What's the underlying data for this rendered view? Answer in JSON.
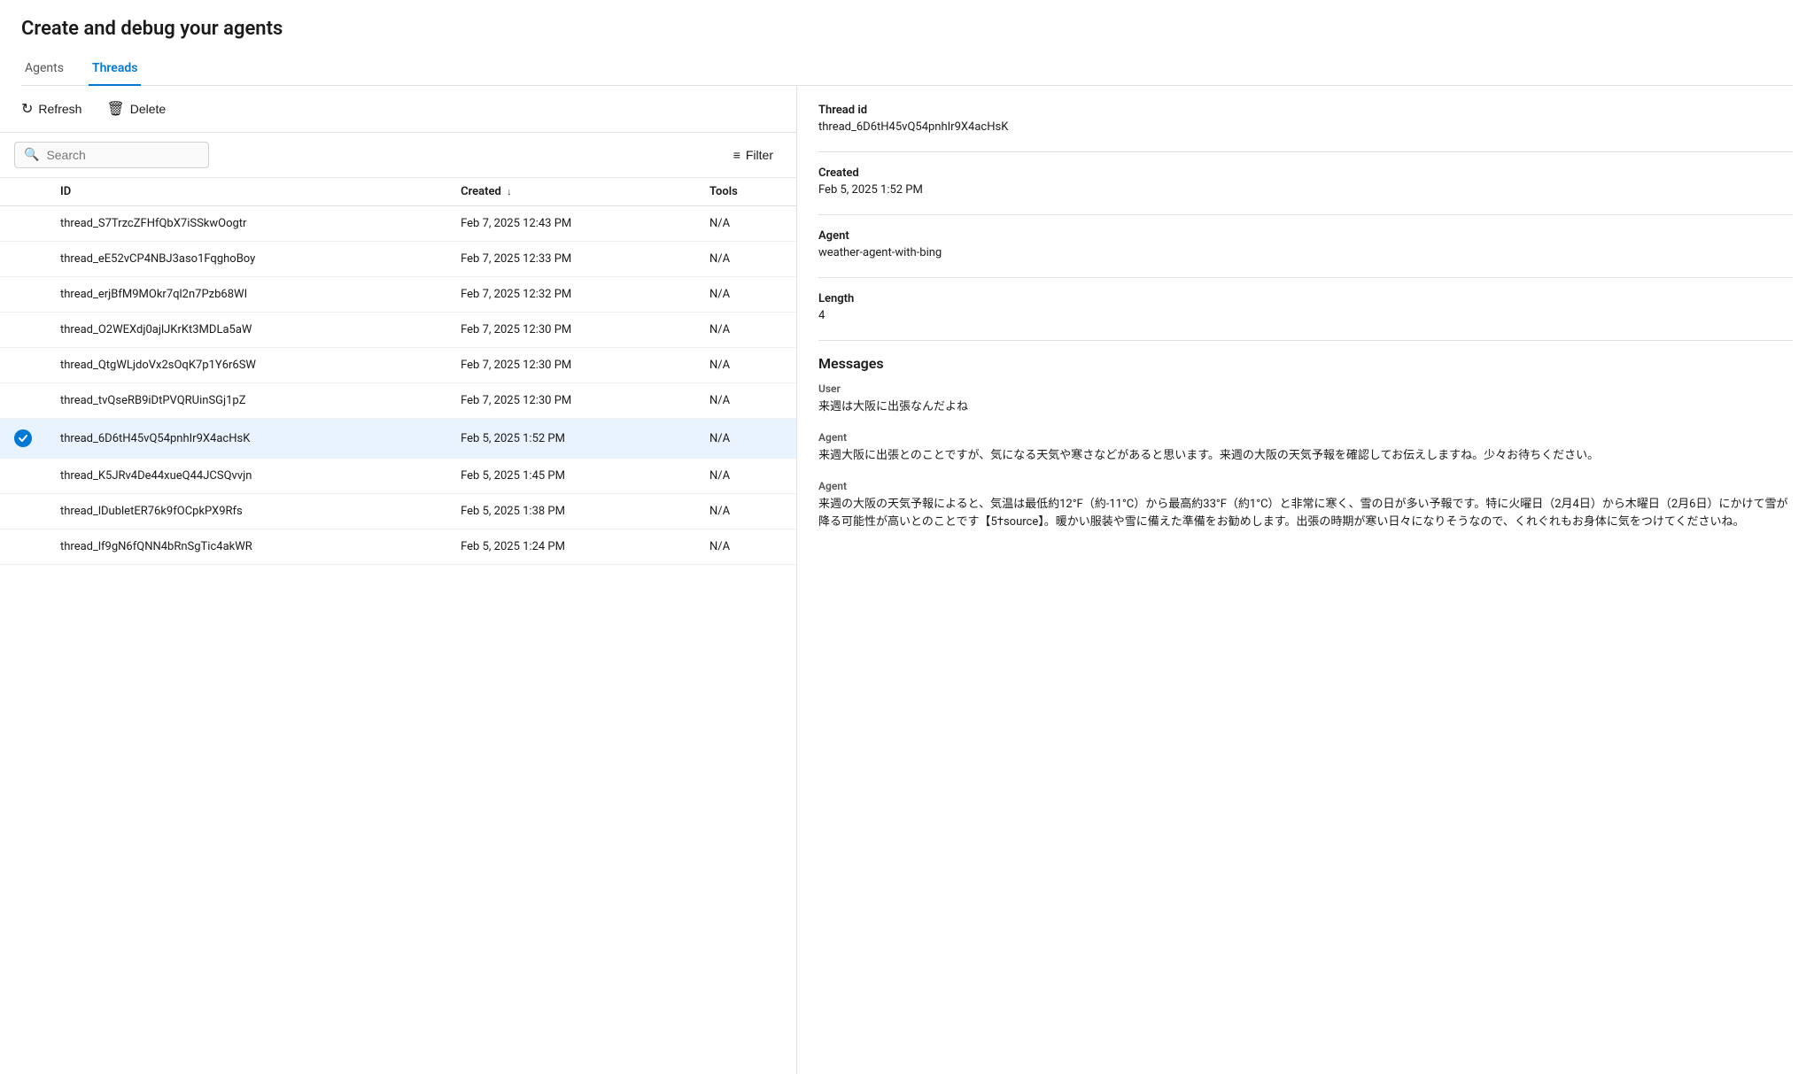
{
  "page": {
    "title": "Create and debug your agents"
  },
  "tabs": [
    {
      "id": "agents",
      "label": "Agents",
      "active": false
    },
    {
      "id": "threads",
      "label": "Threads",
      "active": true
    }
  ],
  "toolbar": {
    "refresh_label": "Refresh",
    "delete_label": "Delete"
  },
  "search": {
    "placeholder": "Search"
  },
  "filter": {
    "label": "Filter"
  },
  "table": {
    "columns": [
      {
        "id": "check",
        "label": ""
      },
      {
        "id": "id",
        "label": "ID"
      },
      {
        "id": "created",
        "label": "Created"
      },
      {
        "id": "tools",
        "label": "Tools"
      }
    ],
    "rows": [
      {
        "id": "thread_S7TrzcZFHfQbX7iSSkwOogtr",
        "created": "Feb 7, 2025 12:43 PM",
        "tools": "N/A",
        "selected": false
      },
      {
        "id": "thread_eE52vCP4NBJ3aso1FqghoBoy",
        "created": "Feb 7, 2025 12:33 PM",
        "tools": "N/A",
        "selected": false
      },
      {
        "id": "thread_erjBfM9MOkr7ql2n7Pzb68WI",
        "created": "Feb 7, 2025 12:32 PM",
        "tools": "N/A",
        "selected": false
      },
      {
        "id": "thread_O2WEXdj0ajlJKrKt3MDLa5aW",
        "created": "Feb 7, 2025 12:30 PM",
        "tools": "N/A",
        "selected": false
      },
      {
        "id": "thread_QtgWLjdoVx2sOqK7p1Y6r6SW",
        "created": "Feb 7, 2025 12:30 PM",
        "tools": "N/A",
        "selected": false
      },
      {
        "id": "thread_tvQseRB9iDtPVQRUinSGj1pZ",
        "created": "Feb 7, 2025 12:30 PM",
        "tools": "N/A",
        "selected": false
      },
      {
        "id": "thread_6D6tH45vQ54pnhIr9X4acHsK",
        "created": "Feb 5, 2025 1:52 PM",
        "tools": "N/A",
        "selected": true
      },
      {
        "id": "thread_K5JRv4De44xueQ44JCSQvvjn",
        "created": "Feb 5, 2025 1:45 PM",
        "tools": "N/A",
        "selected": false
      },
      {
        "id": "thread_lDubletER76k9fOCpkPX9Rfs",
        "created": "Feb 5, 2025 1:38 PM",
        "tools": "N/A",
        "selected": false
      },
      {
        "id": "thread_lf9gN6fQNN4bRnSgTic4akWR",
        "created": "Feb 5, 2025 1:24 PM",
        "tools": "N/A",
        "selected": false
      }
    ]
  },
  "detail": {
    "thread_id_label": "Thread id",
    "thread_id_value": "thread_6D6tH45vQ54pnhIr9X4acHsK",
    "created_label": "Created",
    "created_value": "Feb 5, 2025 1:52 PM",
    "agent_label": "Agent",
    "agent_value": "weather-agent-with-bing",
    "length_label": "Length",
    "length_value": "4",
    "messages_label": "Messages",
    "messages": [
      {
        "role": "User",
        "text": "来週は大阪に出張なんだよね"
      },
      {
        "role": "Agent",
        "text": "来週大阪に出張とのことですが、気になる天気や寒さなどがあると思います。来週の大阪の天気予報を確認してお伝えしますね。少々お待ちください。"
      },
      {
        "role": "Agent",
        "text": "来週の大阪の天気予報によると、気温は最低約12°F（約-11°C）から最高約33°F（約1°C）と非常に寒く、雪の日が多い予報です。特に火曜日（2月4日）から木曜日（2月6日）にかけて雪が降る可能性が高いとのことです【5†source】。暖かい服装や雪に備えた準備をお勧めします。出張の時期が寒い日々になりそうなので、くれぐれもお身体に気をつけてくださいね。"
      }
    ]
  }
}
